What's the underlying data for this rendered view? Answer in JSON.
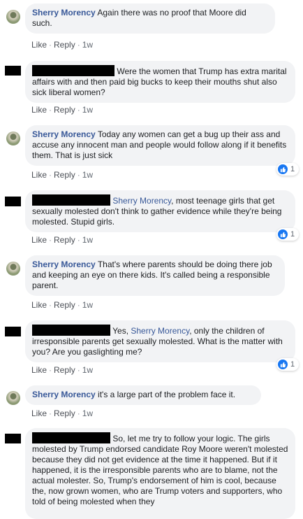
{
  "actions": {
    "like": "Like",
    "reply": "Reply",
    "sep": "·"
  },
  "comments": [
    {
      "author": "Sherry Morency",
      "text": "Again there was no proof that Moore did such.",
      "time": "1w"
    },
    {
      "author": "",
      "text": "Were the women that Trump has extra marital affairs with and then paid big bucks to keep their mouths shut also sick liberal women?",
      "time": "1w"
    },
    {
      "author": "Sherry Morency",
      "text": "Today any women can get a bug up their ass and accuse any innocent man and people would follow along if it benefits them. That is just sick",
      "time": "1w",
      "likes": "1"
    },
    {
      "author": "",
      "mention": "Sherry Morency",
      "text": ", most teenage girls that get sexually molested don't think to gather evidence while they're being molested. Stupid girls.",
      "time": "1w",
      "likes": "1"
    },
    {
      "author": "Sherry Morency",
      "text": "That's where parents should be doing there job and keeping an eye on there kids. It's called being a responsible parent.",
      "time": "1w"
    },
    {
      "author": "",
      "prefix": "Yes, ",
      "mention": "Sherry Morency",
      "text": ", only the children of irresponsible parents get sexually molested. What is the matter with you? Are you gaslighting me?",
      "time": "1w",
      "likes": "1"
    },
    {
      "author": "Sherry Morency",
      "text": "it's a large part of the problem face it.",
      "time": "1w"
    },
    {
      "author": "",
      "text": "So, let me try to follow your logic. The girls molested by Trump endorsed candidate Roy Moore weren't molested because they did not get evidence at the time it happened. But if it happened, it is the irresponsible parents who are to blame, not the actual molester. So, Trump's endorsement of him is cool, because the, now grown women, who are Trump voters and supporters, who told of being molested when they"
    }
  ]
}
